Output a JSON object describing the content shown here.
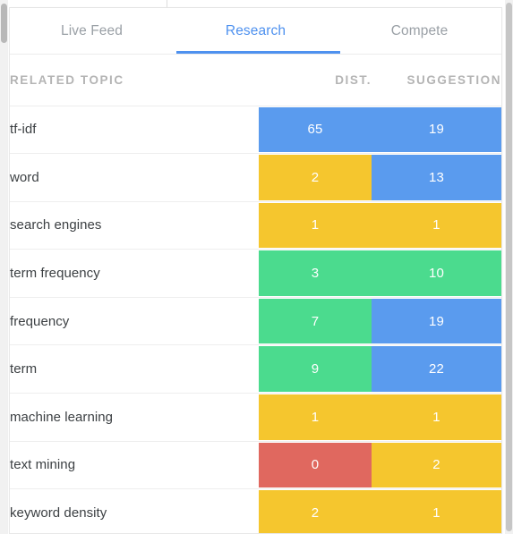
{
  "panel": {
    "scrollbar_left": "vertical-scrollbar",
    "scrollbar_right": "vertical-scrollbar"
  },
  "tabs": [
    {
      "label": "Live Feed",
      "active": false,
      "name": "tab-live-feed"
    },
    {
      "label": "Research",
      "active": true,
      "name": "tab-research"
    },
    {
      "label": "Compete",
      "active": false,
      "name": "tab-compete"
    }
  ],
  "table": {
    "columns": [
      {
        "key": "topic",
        "label": "RELATED TOPIC",
        "align": "left"
      },
      {
        "key": "dist",
        "label": "DIST.",
        "align": "right"
      },
      {
        "key": "suggestion",
        "label": "SUGGESTION",
        "align": "right"
      }
    ],
    "rows": [
      {
        "topic": "tf-idf",
        "dist": "65",
        "dist_color": "blue",
        "dist_wide": true,
        "suggestion": "19",
        "sugg_color": "blue"
      },
      {
        "topic": "word",
        "dist": "2",
        "dist_color": "yellow",
        "dist_wide": false,
        "suggestion": "13",
        "sugg_color": "blue"
      },
      {
        "topic": "search engines",
        "dist": "1",
        "dist_color": "yellow",
        "dist_wide": true,
        "suggestion": "1",
        "sugg_color": "yellow"
      },
      {
        "topic": "term frequency",
        "dist": "3",
        "dist_color": "green",
        "dist_wide": true,
        "suggestion": "10",
        "sugg_color": "green"
      },
      {
        "topic": "frequency",
        "dist": "7",
        "dist_color": "green",
        "dist_wide": false,
        "suggestion": "19",
        "sugg_color": "blue"
      },
      {
        "topic": "term",
        "dist": "9",
        "dist_color": "green",
        "dist_wide": false,
        "suggestion": "22",
        "sugg_color": "blue"
      },
      {
        "topic": "machine learning",
        "dist": "1",
        "dist_color": "yellow",
        "dist_wide": true,
        "suggestion": "1",
        "sugg_color": "yellow"
      },
      {
        "topic": "text mining",
        "dist": "0",
        "dist_color": "red",
        "dist_wide": false,
        "suggestion": "2",
        "sugg_color": "yellow"
      },
      {
        "topic": "keyword density",
        "dist": "2",
        "dist_color": "yellow",
        "dist_wide": true,
        "suggestion": "1",
        "sugg_color": "yellow"
      }
    ]
  },
  "colors": {
    "blue": "#5a9bee",
    "yellow": "#f5c62e",
    "green": "#4bdb8e",
    "red": "#e0685f",
    "accent": "#4e91ef",
    "header_text": "#b4b4b4",
    "body_text": "#3c4043",
    "inactive_tab_text": "#9aa0a6"
  },
  "chart_data": {
    "type": "heatmap",
    "title": "Research — Related Topics",
    "categories": [
      "tf-idf",
      "word",
      "search engines",
      "term frequency",
      "frequency",
      "term",
      "machine learning",
      "text mining",
      "keyword density"
    ],
    "series": [
      {
        "name": "DIST.",
        "values": [
          65,
          2,
          1,
          3,
          7,
          9,
          1,
          0,
          2
        ],
        "cell_colors": [
          "blue",
          "yellow",
          "yellow",
          "green",
          "green",
          "green",
          "yellow",
          "red",
          "yellow"
        ]
      },
      {
        "name": "SUGGESTION",
        "values": [
          19,
          13,
          1,
          10,
          19,
          22,
          1,
          2,
          1
        ],
        "cell_colors": [
          "blue",
          "blue",
          "yellow",
          "green",
          "blue",
          "blue",
          "yellow",
          "yellow",
          "yellow"
        ]
      }
    ],
    "xlabel": "RELATED TOPIC",
    "ylabel": "",
    "legend": [],
    "grid": false,
    "color_scale": {
      "red": "#e0685f",
      "yellow": "#f5c62e",
      "green": "#4bdb8e",
      "blue": "#5a9bee"
    }
  }
}
